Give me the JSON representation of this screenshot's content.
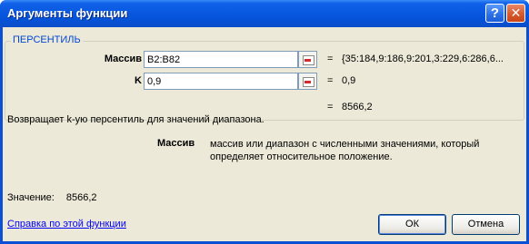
{
  "window": {
    "title": "Аргументы функции",
    "help_button": "?",
    "close_button": "✕"
  },
  "function_group": {
    "title": "ПЕРСЕНТИЛЬ",
    "args": [
      {
        "label": "Массив",
        "value": "B2:B82",
        "equals": "=",
        "result": "{35:184,9:186,9:201,3:229,6:286,6..."
      },
      {
        "label": "K",
        "value": "0,9",
        "equals": "=",
        "result": "0,9"
      }
    ],
    "total_equals": "=",
    "total_result": "8566,2"
  },
  "description": "Возвращает k-ую персентиль для значений диапазона.",
  "arg_help": {
    "name": "Массив",
    "text": "массив или диапазон с численными значениями, который определяет относительное положение."
  },
  "result": {
    "label": "Значение:",
    "value": "8566,2"
  },
  "help_link": "Справка по этой функции",
  "buttons": {
    "ok": "ОК",
    "cancel": "Отмена"
  }
}
